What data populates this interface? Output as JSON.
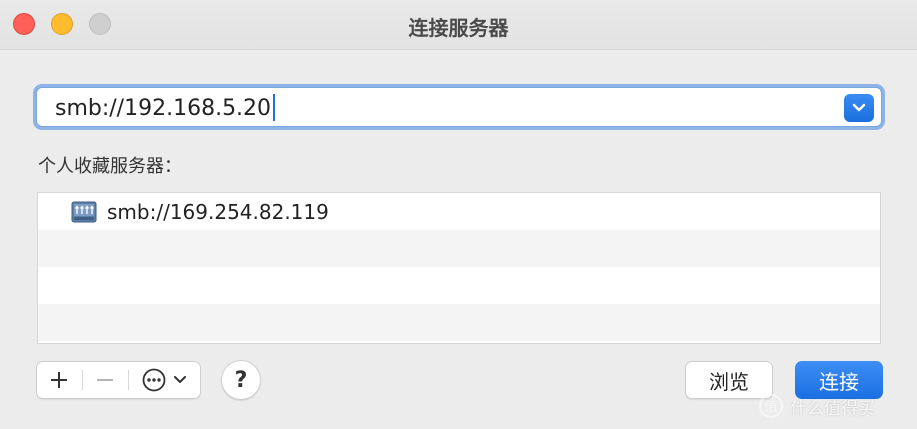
{
  "window": {
    "title": "连接服务器"
  },
  "url_field": {
    "value": "smb://192.168.5.20"
  },
  "favorites": {
    "label": "个人收藏服务器：",
    "items": [
      {
        "label": "smb://169.254.82.119",
        "icon": "network-server-icon"
      }
    ]
  },
  "toolbar": {
    "add_label": "+",
    "remove_label": "—",
    "more_icon": "ellipsis-circle-icon",
    "help_label": "?"
  },
  "buttons": {
    "browse_label": "浏览",
    "connect_label": "连接"
  },
  "watermark": {
    "text": "什么值得买"
  },
  "colors": {
    "accent": "#1b6fe2",
    "close": "#fe5f57",
    "minimize": "#febc2e",
    "zoom": "#cfcfcf"
  }
}
